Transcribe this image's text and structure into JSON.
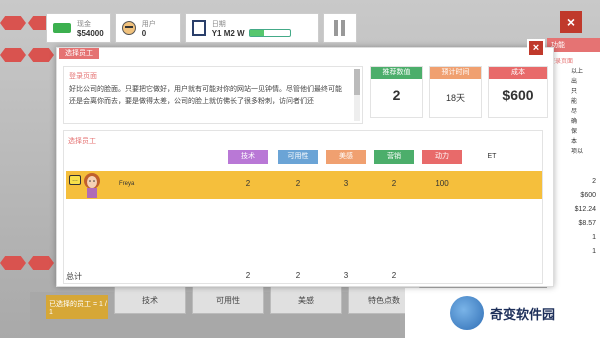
{
  "hud": {
    "cash_label": "现金",
    "cash_value": "$54000",
    "users_label": "用户",
    "users_value": "0",
    "date_label": "日期",
    "date_value": "Y1 M2 W",
    "week_progress": 0.35
  },
  "right_panel": {
    "header": "功能",
    "subtitle": "登录页面",
    "lines": [
      "以上",
      "出",
      "只",
      "能",
      "尽",
      "确",
      "保",
      "本",
      "项以"
    ],
    "numbers": [
      "2",
      "$600",
      "$12.24",
      "$8.57",
      "1",
      "1"
    ]
  },
  "bottom": {
    "selected_label": "已选择的员工 = 1 / 1",
    "tabs": [
      "技术",
      "可用性",
      "美感",
      "特色点数"
    ]
  },
  "watermark": {
    "text": "奇变软件园"
  },
  "dialog": {
    "title": "选择员工",
    "close_label": "×",
    "desc_title": "登录页面",
    "desc_text": "好比公司的脸面。只要把它做好，用户就有可能对你的网站一见钟情。尽管他们最终可能还是会离你而去，要是做得太差，公司的脸上就仿佛长了很多粉刺，访问者们还",
    "stats": [
      {
        "label": "推荐数值",
        "value": "2",
        "color": "#4cae6b"
      },
      {
        "label": "预计时间",
        "value": "18天",
        "color": "#f0a070"
      },
      {
        "label": "成本",
        "value": "$600",
        "color": "#e86a6a"
      }
    ],
    "team_label": "选择员工",
    "columns": [
      {
        "label": "技术",
        "color": "#b978d6"
      },
      {
        "label": "可用性",
        "color": "#6ba4d6"
      },
      {
        "label": "美感",
        "color": "#f0a070"
      },
      {
        "label": "营销",
        "color": "#4cae6b"
      },
      {
        "label": "动力",
        "color": "#e86a6a"
      },
      {
        "label": "ET",
        "color": ""
      }
    ],
    "employee": {
      "chat": "…",
      "name": "Freya",
      "values": [
        "2",
        "2",
        "3",
        "2",
        "100",
        ""
      ]
    },
    "total_label": "总计",
    "totals": [
      "2",
      "2",
      "3",
      "2"
    ]
  }
}
